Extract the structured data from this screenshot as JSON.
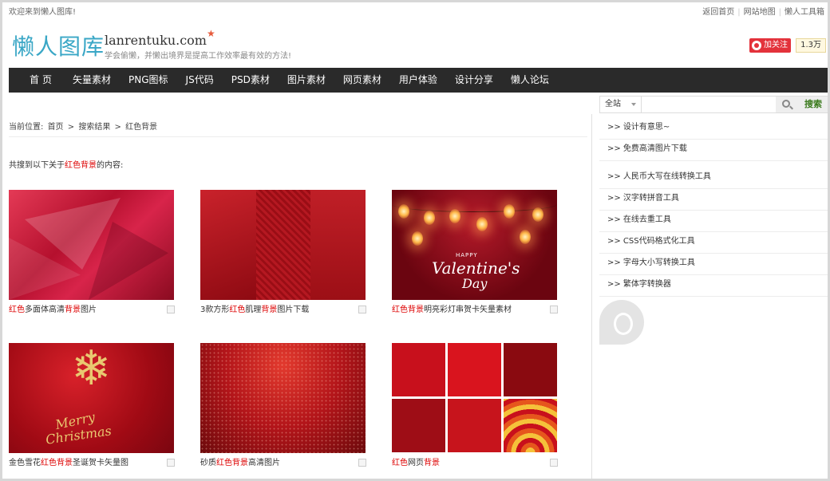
{
  "topbar": {
    "welcome": "欢迎来到懒人图库!",
    "links": [
      "返回首页",
      "网站地图",
      "懒人工具箱"
    ]
  },
  "header": {
    "logo_cn": "懒人图库",
    "logo_en": "lanrentuku.com",
    "slogan": "学会偷懒，并懒出境界是提高工作效率最有效的方法!",
    "follow_label": "加关注",
    "fans_count": "1.3万"
  },
  "nav": {
    "items": [
      "首页",
      "矢量素材",
      "PNG图标",
      "JS代码",
      "PSD素材",
      "图片素材",
      "网页素材",
      "用户体验",
      "设计分享",
      "懒人论坛"
    ]
  },
  "search": {
    "scope": "全站",
    "value": "",
    "button_label": "搜索"
  },
  "breadcrumb": {
    "prefix": "当前位置:",
    "items": [
      "首页",
      "搜索结果",
      "红色背景"
    ],
    "separator": ">"
  },
  "result": {
    "prefix": "共搜到以下关于",
    "keyword": "红色背景",
    "suffix": "的内容:"
  },
  "cards": [
    {
      "parts": [
        {
          "t": "红色",
          "hl": true
        },
        {
          "t": "多面体高清",
          "hl": false
        },
        {
          "t": "背景",
          "hl": true
        },
        {
          "t": "图片",
          "hl": false
        }
      ]
    },
    {
      "parts": [
        {
          "t": "3款方形",
          "hl": false
        },
        {
          "t": "红色",
          "hl": true
        },
        {
          "t": "肌理",
          "hl": false
        },
        {
          "t": "背景",
          "hl": true
        },
        {
          "t": "图片下载",
          "hl": false
        }
      ]
    },
    {
      "parts": [
        {
          "t": "红色背景",
          "hl": true
        },
        {
          "t": "明亮彩灯串贺卡矢量素材",
          "hl": false
        }
      ]
    },
    {
      "parts": [
        {
          "t": "金色雪花",
          "hl": false
        },
        {
          "t": "红色背景",
          "hl": true
        },
        {
          "t": "圣诞贺卡矢量图",
          "hl": false
        }
      ]
    },
    {
      "parts": [
        {
          "t": "砂质",
          "hl": false
        },
        {
          "t": "红色背景",
          "hl": true
        },
        {
          "t": "高清图片",
          "hl": false
        }
      ]
    },
    {
      "parts": [
        {
          "t": "红色",
          "hl": true
        },
        {
          "t": "网页",
          "hl": false
        },
        {
          "t": "背景",
          "hl": true
        }
      ]
    }
  ],
  "card_images": {
    "valentine_happy": "HAPPY",
    "valentine_line1": "Valentine's",
    "valentine_line2": "Day",
    "xmas_line1": "Merry",
    "xmas_line2": "Christmas"
  },
  "sidebar": {
    "group1": [
      ">> 设计有意思~",
      ">> 免费高清图片下载"
    ],
    "group2": [
      ">> 人民币大写在线转换工具",
      ">> 汉字转拼音工具",
      ">> 在线去重工具",
      ">> CSS代码格式化工具",
      ">> 字母大小写转换工具",
      ">> 繁体字转换器"
    ]
  },
  "colors": {
    "nav_bg": "#2a2a2a",
    "highlight": "#dd0000",
    "logo": "#3aa7c6",
    "search_btn_text": "#3a7a1c"
  }
}
